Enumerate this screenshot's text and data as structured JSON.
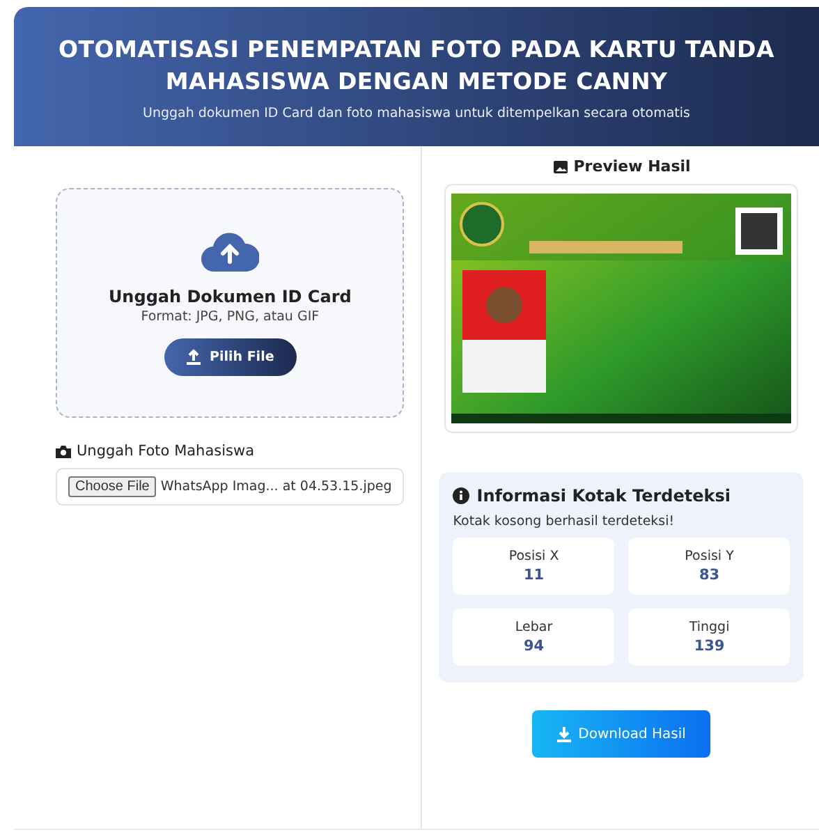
{
  "header": {
    "title": "OTOMATISASI PENEMPATAN FOTO PADA KARTU TANDA MAHASISWA DENGAN METODE CANNY",
    "subtitle": "Unggah dokumen ID Card dan foto mahasiswa untuk ditempelkan secara otomatis"
  },
  "upload": {
    "title": "Unggah Dokumen ID Card",
    "hint": "Format: JPG, PNG, atau GIF",
    "button": "Pilih File"
  },
  "photo": {
    "label": "Unggah Foto Mahasiswa",
    "button": "Choose File",
    "value": "WhatsApp Imag... at 04.53.15.jpeg"
  },
  "preview": {
    "title": "Preview Hasil"
  },
  "info": {
    "title": "Informasi Kotak Terdeteksi",
    "message": "Kotak kosong berhasil terdeteksi!",
    "stats": [
      {
        "label": "Posisi X",
        "value": "11"
      },
      {
        "label": "Posisi Y",
        "value": "83"
      },
      {
        "label": "Lebar",
        "value": "94"
      },
      {
        "label": "Tinggi",
        "value": "139"
      }
    ]
  },
  "download": "Download Hasil"
}
